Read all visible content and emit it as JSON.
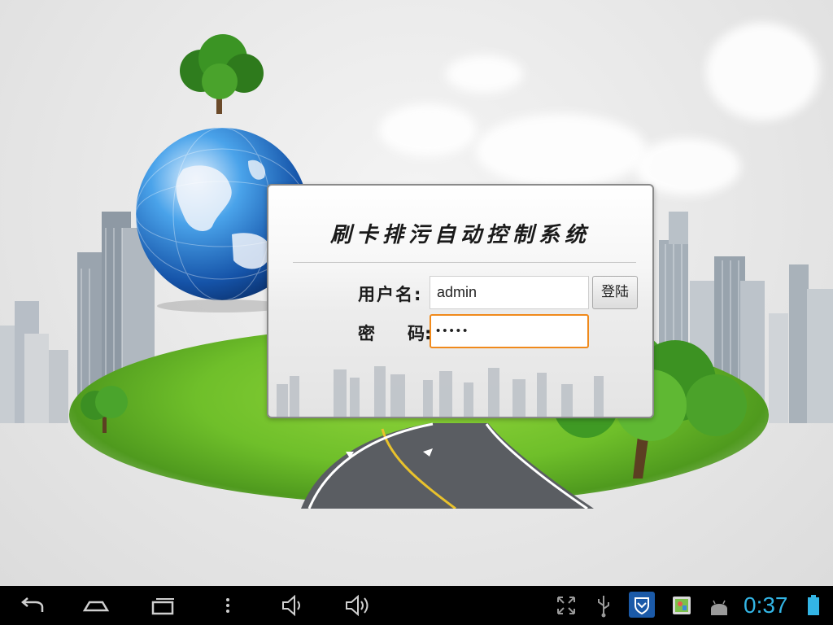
{
  "app": {
    "title": "刷卡排污自动控制系统"
  },
  "login_form": {
    "username_label": "用户名:",
    "password_label_left": "密",
    "password_label_right": "码:",
    "username_value": "admin",
    "password_value": "•••••",
    "login_button_label": "登陆"
  },
  "status_bar": {
    "clock": "0:37",
    "accent_color": "#33b5e5",
    "icons": [
      "back-icon",
      "home-icon",
      "recent-apps-icon",
      "menu-dots-icon",
      "volume-down-icon",
      "volume-up-icon",
      "screenshot-expand-icon",
      "usb-icon",
      "shield-app-icon",
      "photo-app-icon",
      "android-debug-icon",
      "battery-icon"
    ]
  },
  "colors": {
    "focus_border": "#f08a1c",
    "panel_border": "#8a8a8a"
  }
}
